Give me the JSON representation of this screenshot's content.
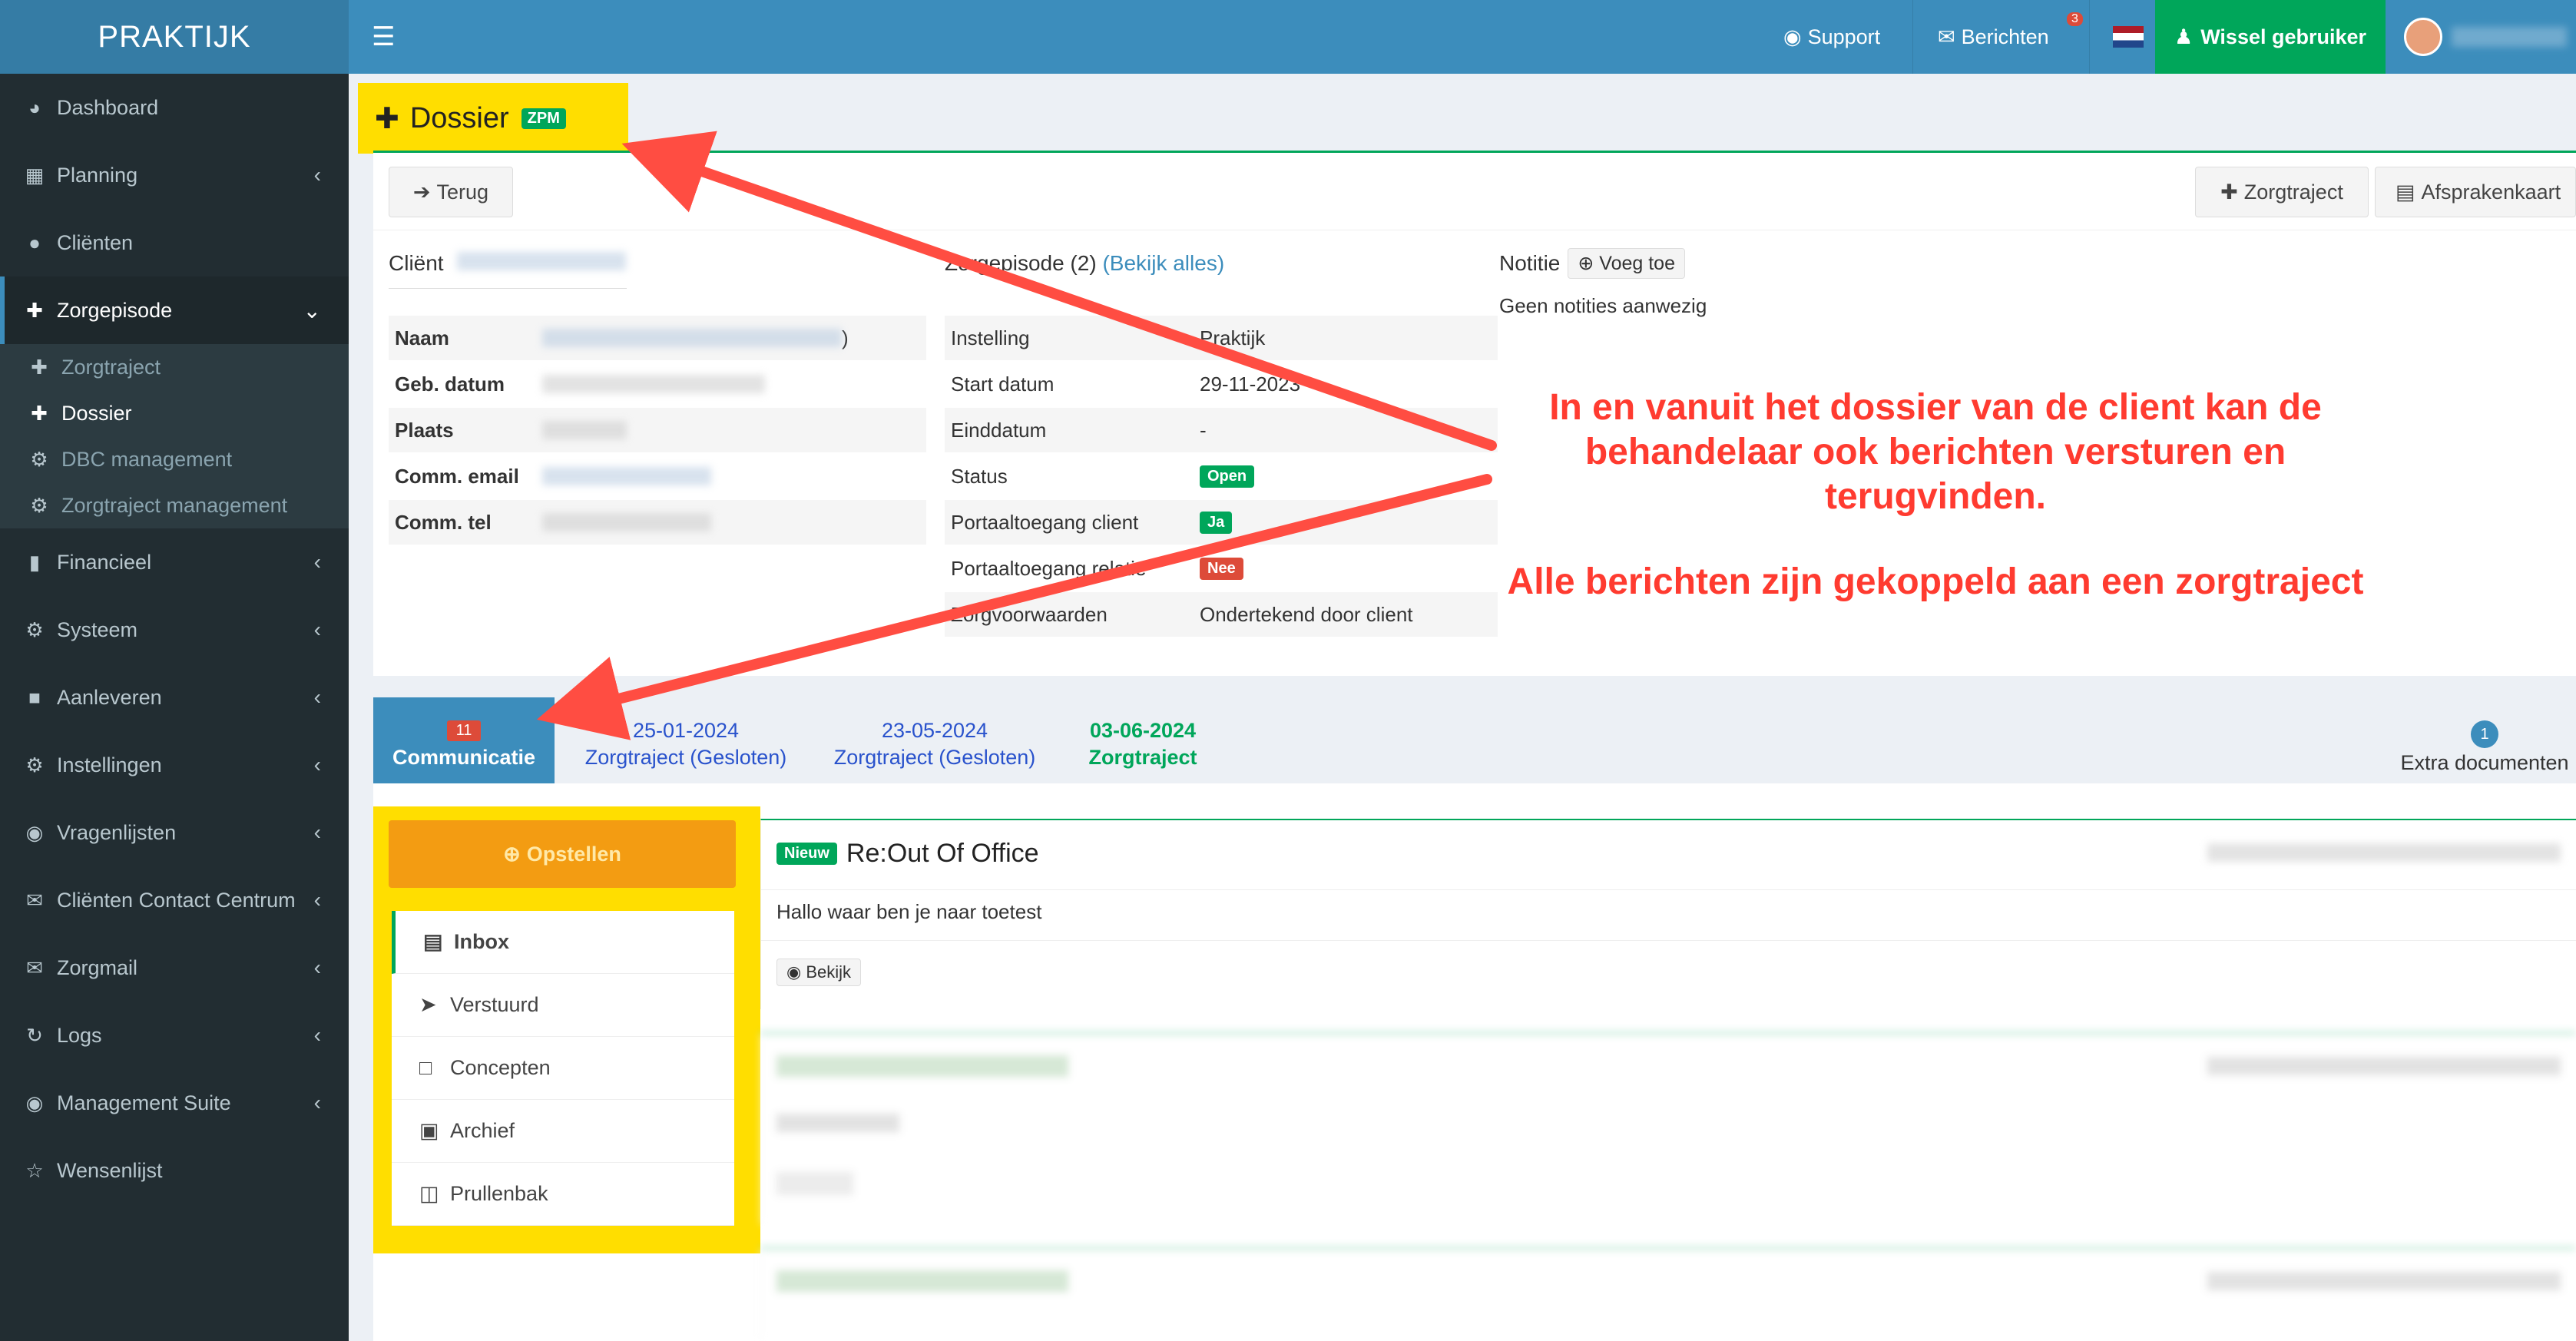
{
  "app": {
    "logo": "PRAKTIJK"
  },
  "topbar": {
    "support": "Support",
    "berichten": "Berichten",
    "berichten_count": "3",
    "wissel": "Wissel gebruiker"
  },
  "sidebar": {
    "items": [
      {
        "label": "Dashboard",
        "icon": "dashboard-icon"
      },
      {
        "label": "Planning",
        "icon": "calendar-icon"
      },
      {
        "label": "Cliënten",
        "icon": "user-icon"
      },
      {
        "label": "Zorgepisode",
        "icon": "medkit-icon"
      },
      {
        "label": "Financieel",
        "icon": "book-icon"
      },
      {
        "label": "Systeem",
        "icon": "gears-icon"
      },
      {
        "label": "Aanleveren",
        "icon": "truck-icon"
      },
      {
        "label": "Instellingen",
        "icon": "gear-icon"
      },
      {
        "label": "Vragenlijsten",
        "icon": "globe-icon"
      },
      {
        "label": "Cliënten Contact Centrum",
        "icon": "envelope-icon"
      },
      {
        "label": "Zorgmail",
        "icon": "envelope-icon"
      },
      {
        "label": "Logs",
        "icon": "history-icon"
      },
      {
        "label": "Management Suite",
        "icon": "globe-icon"
      },
      {
        "label": "Wensenlijst",
        "icon": "star-icon"
      }
    ],
    "sub": [
      "Zorgtraject",
      "Dossier",
      "DBC management",
      "Zorgtraject management"
    ]
  },
  "page": {
    "title": "Dossier",
    "badge": "ZPM",
    "back": "Terug",
    "zorgtraject_btn": "Zorgtraject",
    "afspraken_btn": "Afsprakenkaart"
  },
  "client": {
    "heading": "Cliënt",
    "rows": [
      {
        "k": "Naam",
        "v": ")"
      },
      {
        "k": "Geb. datum",
        "v": ""
      },
      {
        "k": "Plaats",
        "v": ""
      },
      {
        "k": "Comm. email",
        "v": ""
      },
      {
        "k": "Comm. tel",
        "v": ""
      }
    ]
  },
  "episode": {
    "heading": "Zorgepisode (2)",
    "link": "(Bekijk alles)",
    "rows": [
      {
        "k": "Instelling",
        "v": "Praktijk"
      },
      {
        "k": "Start datum",
        "v": "29-11-2023"
      },
      {
        "k": "Einddatum",
        "v": "-"
      },
      {
        "k": "Status",
        "v": "Open",
        "pill": "#00a65a"
      },
      {
        "k": "Portaaltoegang client",
        "v": "Ja",
        "pill": "#00a65a"
      },
      {
        "k": "Portaaltoegang relatie",
        "v": "Nee",
        "pill": "#dd4b39"
      },
      {
        "k": "Zorgvoorwaarden",
        "v": "Ondertekend door client"
      }
    ]
  },
  "notitie": {
    "heading": "Notitie",
    "add": "Voeg toe",
    "empty": "Geen notities aanwezig"
  },
  "tabs": {
    "comm": "Communicatie",
    "comm_count": "11",
    "t1_date": "25-01-2024",
    "t1_label": "Zorgtraject (Gesloten)",
    "t2_date": "23-05-2024",
    "t2_label": "Zorgtraject (Gesloten)",
    "t3_date": "03-06-2024",
    "t3_label": "Zorgtraject",
    "extra": "Extra documenten",
    "extra_count": "1"
  },
  "mail": {
    "compose": "Opstellen",
    "folders": [
      "Inbox",
      "Verstuurd",
      "Concepten",
      "Archief",
      "Prullenbak"
    ],
    "msg1": {
      "badge": "Nieuw",
      "subject": "Re:Out Of Office",
      "body": "Hallo waar ben je naar toetest",
      "view": "Bekijk"
    }
  },
  "annotation": {
    "line1": "In en vanuit het dossier van de client kan de",
    "line2": "behandelaar ook berichten versturen en",
    "line3": "terugvinden.",
    "line4": "Alle berichten zijn gekoppeld aan een zorgtraject"
  },
  "colors": {
    "accent": "#3c8dbc",
    "sidebar": "#222d32",
    "highlight": "#ffde00",
    "success": "#00a65a",
    "danger": "#dd4b39",
    "annotation": "#ff3b30"
  }
}
